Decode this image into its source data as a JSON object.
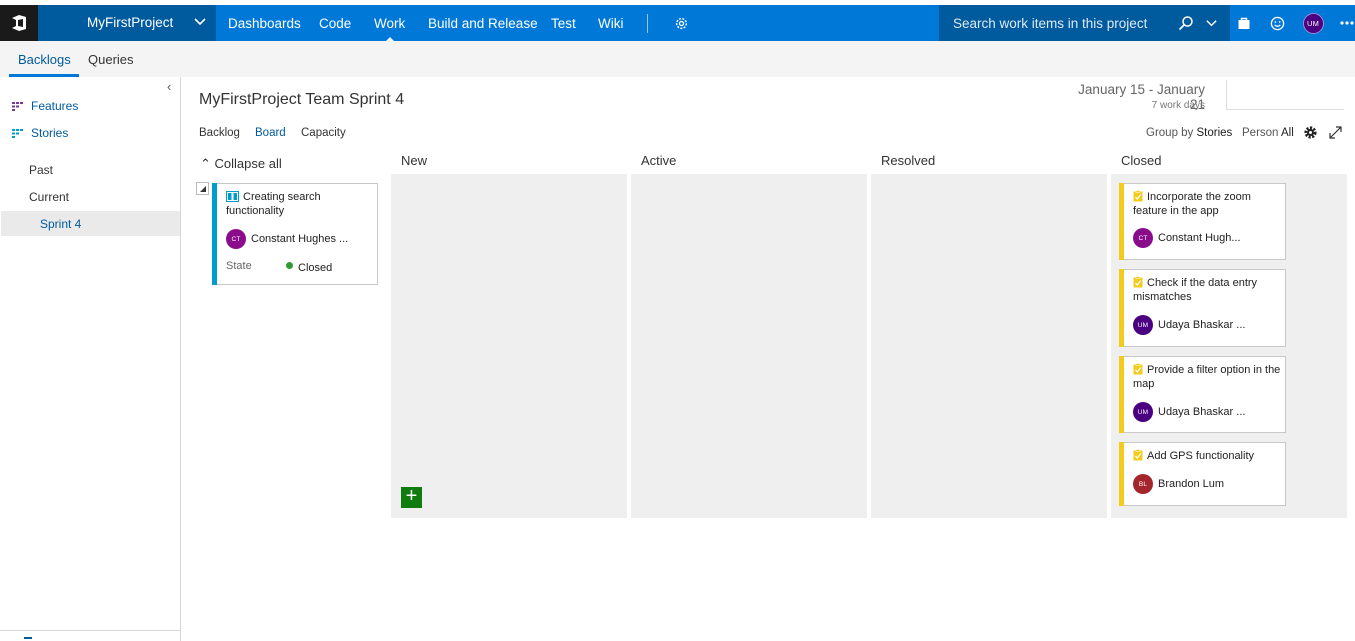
{
  "topnav": {
    "project_name": "MyFirstProject",
    "items": [
      "Dashboards",
      "Code",
      "Work",
      "Build and Release",
      "Test",
      "Wiki"
    ],
    "active_item": "Work",
    "search_placeholder": "Search work items in this project",
    "user_initials": "UM",
    "colors": {
      "bar": "#0078d7",
      "dark": "#005a9e"
    }
  },
  "subnav": {
    "tabs": [
      "Backlogs",
      "Queries"
    ],
    "active": "Backlogs"
  },
  "leftpane": {
    "backlog_levels": [
      "Features",
      "Stories"
    ],
    "iterations": [
      "Past",
      "Current",
      "Sprint 4"
    ],
    "selected": "Sprint 4"
  },
  "header": {
    "title": "MyFirstProject Team Sprint 4",
    "dates": "January 15 - January 21",
    "work_days": "7 work days",
    "pivots": [
      "Backlog",
      "Board",
      "Capacity"
    ],
    "active_pivot": "Board",
    "group_by_label": "Group by",
    "group_by_value": "Stories",
    "person_label": "Person",
    "person_value": "All"
  },
  "board": {
    "collapse_all": "Collapse all",
    "columns": [
      "New",
      "Active",
      "Resolved",
      "Closed"
    ],
    "parent_card": {
      "title": "Creating search functionality",
      "assignee": "Constant Hughes ...",
      "assignee_initials": "CT",
      "state_label": "State",
      "state_value": "Closed",
      "color": "#009ccc"
    },
    "closed_cards": [
      {
        "title": "Incorporate the zoom feature in the app",
        "assignee": "Constant Hugh...",
        "initials": "CT",
        "avatar_color": "#8b0c8b"
      },
      {
        "title": "Check if the data entry mismatches",
        "assignee": "Udaya Bhaskar ...",
        "initials": "UM",
        "avatar_color": "#4b0082"
      },
      {
        "title": "Provide a filter option in the map",
        "assignee": "Udaya Bhaskar ...",
        "initials": "UM",
        "avatar_color": "#4b0082"
      },
      {
        "title": "Add GPS functionality",
        "assignee": "Brandon Lum",
        "initials": "BL",
        "avatar_color": "#a4262c"
      }
    ],
    "task_color": "#f2cb1d"
  }
}
